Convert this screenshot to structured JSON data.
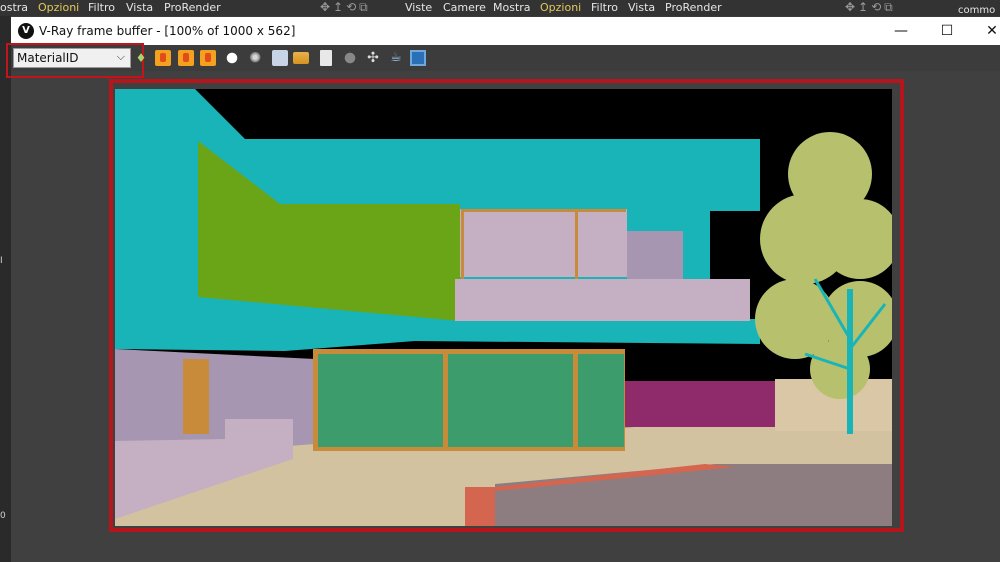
{
  "host_menu": {
    "left_items": [
      {
        "label": "ostra"
      },
      {
        "label": "Opzioni",
        "highlight": true
      },
      {
        "label": "Filtro"
      },
      {
        "label": "Vista"
      },
      {
        "label": "ProRender"
      }
    ],
    "right_items": [
      {
        "label": "Viste"
      },
      {
        "label": "Camere"
      },
      {
        "label": "Mostra"
      },
      {
        "label": "Opzioni",
        "highlight": true
      },
      {
        "label": "Filtro"
      },
      {
        "label": "Vista"
      },
      {
        "label": "ProRender"
      }
    ],
    "right_corner_text": "commo",
    "left_strip_labels": [
      "I",
      "0"
    ]
  },
  "window": {
    "title": "V-Ray frame buffer - [100% of 1000 x 562]",
    "app_icon": "vray-logo-icon",
    "controls": {
      "minimize": "—",
      "maximize": "☐",
      "close": "✕"
    }
  },
  "toolbar": {
    "channel_select_value": "MaterialID",
    "icons": [
      "pin-icon",
      "red-channel-icon",
      "green-channel-icon",
      "blue-channel-icon",
      "white-alpha-icon",
      "mono-icon",
      "save-image-icon",
      "load-image-icon",
      "clear-image-icon",
      "region-render-icon",
      "pan-icon",
      "teapot-render-icon",
      "display-icon"
    ]
  },
  "colors": {
    "highlight_red": "#b4161b",
    "sky": "#000000",
    "cyan": "#19b4b8",
    "lime": "#6aa517",
    "lilac": "#c4afc3",
    "green_glass": "#3d9c6b",
    "frame_ochre": "#c88b39",
    "magenta": "#8f2a6b",
    "ground": "#d3c29f",
    "pool": "#8e7d80",
    "tree": "#b7c16d"
  }
}
